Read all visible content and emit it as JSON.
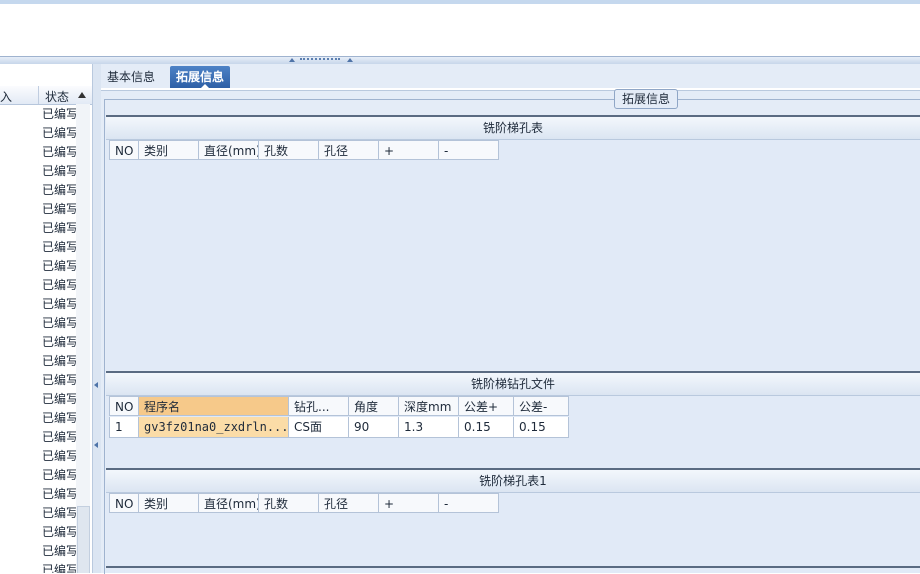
{
  "left_panel": {
    "header_cut": "入",
    "header_status": "状态",
    "rows": [
      "已编写",
      "已编写",
      "已编写",
      "已编写",
      "已编写",
      "已编写",
      "已编写",
      "已编写",
      "已编写",
      "已编写",
      "已编写",
      "已编写",
      "已编写",
      "已编写",
      "已编写",
      "已编写",
      "已编写",
      "已编写",
      "已编写",
      "已编写",
      "已编写",
      "已编写",
      "已编写",
      "已编写",
      "已编写"
    ]
  },
  "tabs": {
    "basic": "基本信息",
    "extended": "拓展信息"
  },
  "group_label": "拓展信息",
  "sections": [
    {
      "title": "铣阶梯孔表",
      "columns": [
        "NO",
        "类别",
        "直径(mm)",
        "孔数",
        "孔径",
        "+",
        "-"
      ]
    },
    {
      "title": "铣阶梯钻孔文件",
      "columns": [
        "NO",
        "程序名",
        "钻孔...",
        "角度",
        "深度mm",
        "公差+",
        "公差-"
      ],
      "rows": [
        [
          "1",
          "gv3fz01na0_zxdrln...",
          "CS面",
          "90",
          "1.3",
          "0.15",
          "0.15"
        ]
      ]
    },
    {
      "title": "铣阶梯孔表1",
      "columns": [
        "NO",
        "类别",
        "直径(mm)",
        "孔数",
        "孔径",
        "+",
        "-"
      ]
    }
  ],
  "colors": {
    "active_tab": "#3a6db5",
    "selected_header": "#f6c98a",
    "panel_bg": "#e1eaf7"
  }
}
